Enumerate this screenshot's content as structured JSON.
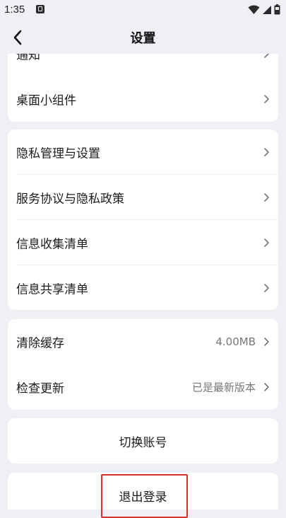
{
  "status_bar": {
    "time": "1:35",
    "icons": [
      "notification-icon",
      "wifi-icon",
      "signal-icon",
      "battery-icon"
    ]
  },
  "header": {
    "title": "设置",
    "back_icon": "chevron-left-icon"
  },
  "sections": {
    "notifications": {
      "partial_label": "通知"
    },
    "widget": {
      "label": "桌面小组件"
    },
    "privacy": {
      "items": [
        {
          "label": "隐私管理与设置"
        },
        {
          "label": "服务协议与隐私政策"
        },
        {
          "label": "信息收集清单"
        },
        {
          "label": "信息共享清单"
        }
      ]
    },
    "storage": {
      "clear_cache": {
        "label": "清除缓存",
        "value": "4.00MB"
      },
      "check_update": {
        "label": "检查更新",
        "value": "已是最新版本"
      }
    },
    "switch_account": {
      "label": "切换账号"
    },
    "logout": {
      "label": "退出登录"
    }
  },
  "colors": {
    "background": "#eef0f6",
    "card": "#ffffff",
    "text": "#1c1c1c",
    "secondary_text": "#777777",
    "highlight": "#d8322f"
  }
}
